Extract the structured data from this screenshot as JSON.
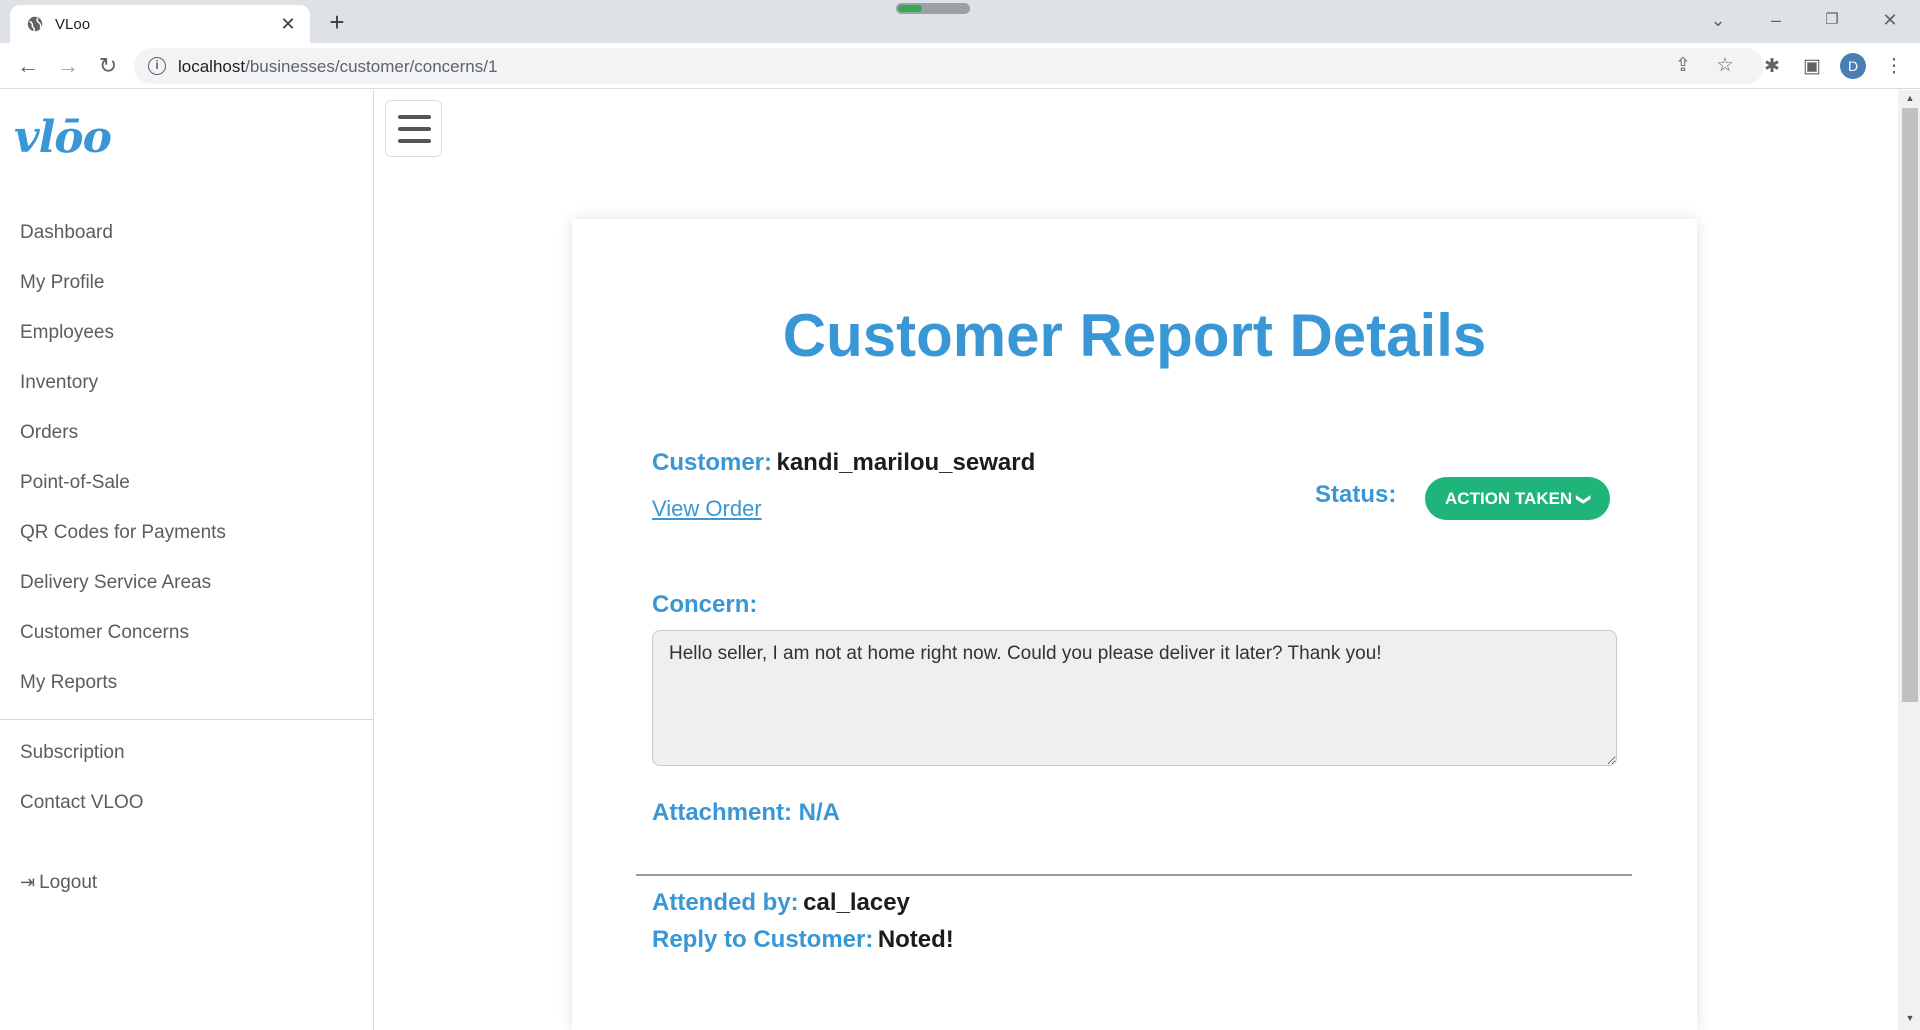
{
  "browser": {
    "tab_title": "VLoo",
    "url_host": "localhost",
    "url_path": "/businesses/customer/concerns/1",
    "profile_initial": "D"
  },
  "sidebar": {
    "logo": "vlōo",
    "items": [
      {
        "label": "Dashboard"
      },
      {
        "label": "My Profile"
      },
      {
        "label": "Employees"
      },
      {
        "label": "Inventory"
      },
      {
        "label": "Orders"
      },
      {
        "label": "Point-of-Sale"
      },
      {
        "label": "QR Codes for Payments"
      },
      {
        "label": "Delivery Service Areas"
      },
      {
        "label": "Customer Concerns"
      },
      {
        "label": "My Reports"
      }
    ],
    "secondary_items": [
      {
        "label": "Subscription"
      },
      {
        "label": "Contact VLOO"
      }
    ],
    "logout_label": "Logout"
  },
  "report": {
    "title": "Customer Report Details",
    "customer_label": "Customer:",
    "customer_value": "kandi_marilou_seward",
    "view_order_label": "View Order",
    "status_label": "Status:",
    "status_value": "ACTION TAKEN",
    "concern_label": "Concern:",
    "concern_text": "Hello seller, I am not at home right now. Could you please deliver it later? Thank you!",
    "attachment_label": "Attachment: N/A",
    "attended_label": "Attended by:",
    "attended_value": "cal_lacey",
    "reply_label": "Reply to Customer:",
    "reply_value": "Noted!"
  },
  "colors": {
    "accent": "#3a97d6",
    "status_green": "#1fb57a"
  }
}
